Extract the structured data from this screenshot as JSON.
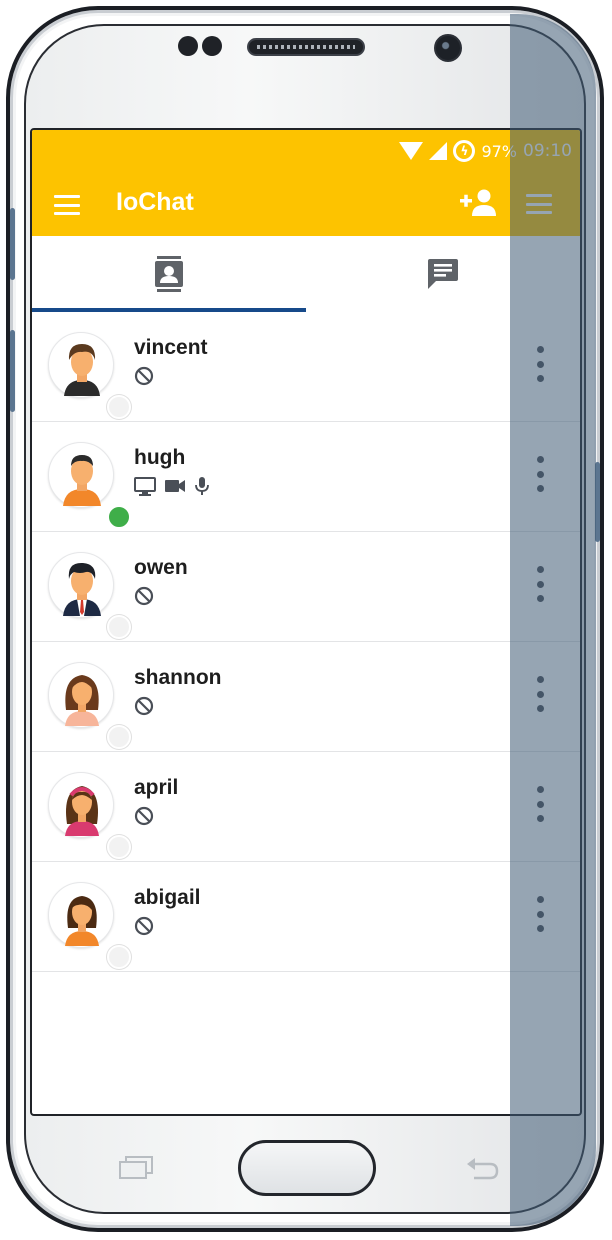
{
  "status_bar": {
    "battery_percent": "97%",
    "time": "09:10",
    "icons": [
      "wifi-icon",
      "cell-signal-icon",
      "battery-charging-icon"
    ]
  },
  "toolbar": {
    "title": "IoChat",
    "icons": [
      "hamburger-menu-icon",
      "add-person-icon",
      "menu-icon"
    ]
  },
  "tabs": [
    {
      "name": "contacts",
      "icon": "contacts-icon",
      "selected": true
    },
    {
      "name": "chats",
      "icon": "chat-icon",
      "selected": false
    }
  ],
  "contacts": [
    {
      "name": "vincent",
      "presence": "offline",
      "capabilities": [
        "blocked-icon"
      ]
    },
    {
      "name": "hugh",
      "presence": "online",
      "capabilities": [
        "screen-share-icon",
        "video-icon",
        "microphone-icon"
      ]
    },
    {
      "name": "owen",
      "presence": "offline",
      "capabilities": [
        "blocked-icon"
      ]
    },
    {
      "name": "shannon",
      "presence": "offline",
      "capabilities": [
        "blocked-icon"
      ]
    },
    {
      "name": "april",
      "presence": "offline",
      "capabilities": [
        "blocked-icon"
      ]
    },
    {
      "name": "abigail",
      "presence": "offline",
      "capabilities": [
        "blocked-icon"
      ]
    }
  ],
  "colors": {
    "app_bar": "#fdc300",
    "tab_indicator": "#174a8a",
    "online": "#3fae49",
    "offline": "#f2f2f2"
  }
}
